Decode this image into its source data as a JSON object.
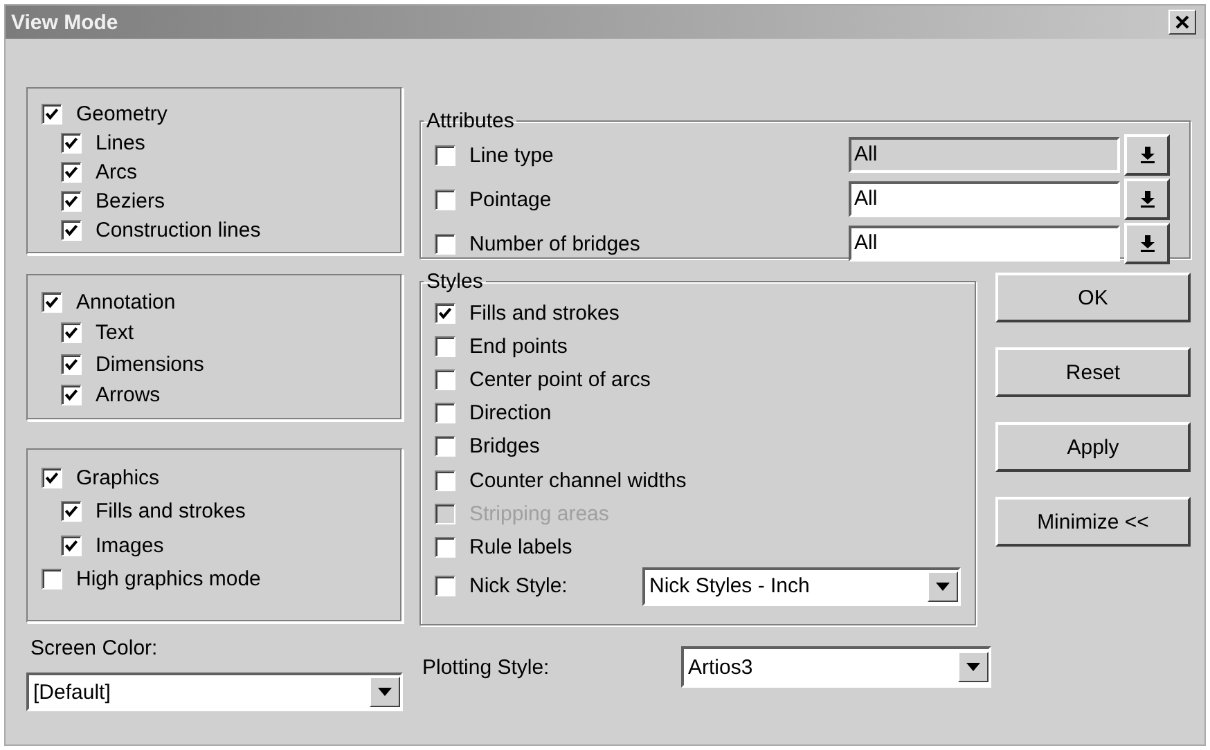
{
  "window": {
    "title": "View Mode"
  },
  "groups": [
    {
      "items": [
        {
          "label": "Geometry",
          "checked": true,
          "children": [
            {
              "label": "Lines",
              "checked": true
            },
            {
              "label": "Arcs",
              "checked": true
            },
            {
              "label": "Beziers",
              "checked": true
            },
            {
              "label": "Construction lines",
              "checked": true
            }
          ]
        }
      ]
    },
    {
      "items": [
        {
          "label": "Annotation",
          "checked": true,
          "children": [
            {
              "label": "Text",
              "checked": true
            },
            {
              "label": "Dimensions",
              "checked": true
            },
            {
              "label": "Arrows",
              "checked": true
            }
          ]
        }
      ]
    },
    {
      "items": [
        {
          "label": "Graphics",
          "checked": true,
          "children": [
            {
              "label": "Fills and strokes",
              "checked": true
            },
            {
              "label": "Images",
              "checked": true
            }
          ]
        },
        {
          "label": "High graphics mode",
          "checked": false
        }
      ]
    }
  ],
  "screen_color": {
    "label": "Screen Color:",
    "value": "[Default]"
  },
  "attributes": {
    "title": "Attributes",
    "rows": [
      {
        "label": "Line type",
        "checked": false,
        "value": "All",
        "disabled": true
      },
      {
        "label": "Pointage",
        "checked": false,
        "value": "All",
        "disabled": false
      },
      {
        "label": "Number of bridges",
        "checked": false,
        "value": "All",
        "disabled": false
      }
    ]
  },
  "styles": {
    "title": "Styles",
    "items": [
      {
        "label": "Fills and strokes",
        "checked": true,
        "disabled": false
      },
      {
        "label": "End points",
        "checked": false,
        "disabled": false
      },
      {
        "label": "Center point of arcs",
        "checked": false,
        "disabled": false
      },
      {
        "label": "Direction",
        "checked": false,
        "disabled": false
      },
      {
        "label": "Bridges",
        "checked": false,
        "disabled": false
      },
      {
        "label": "Counter channel widths",
        "checked": false,
        "disabled": false
      },
      {
        "label": "Stripping areas",
        "checked": false,
        "disabled": true
      },
      {
        "label": "Rule labels",
        "checked": false,
        "disabled": false
      }
    ],
    "nick_style": {
      "label": "Nick Style:",
      "checked": false,
      "value": "Nick Styles - Inch"
    }
  },
  "plotting_style": {
    "label": "Plotting Style:",
    "value": "Artios3"
  },
  "buttons": [
    "OK",
    "Reset",
    "Apply",
    "Minimize <<"
  ]
}
